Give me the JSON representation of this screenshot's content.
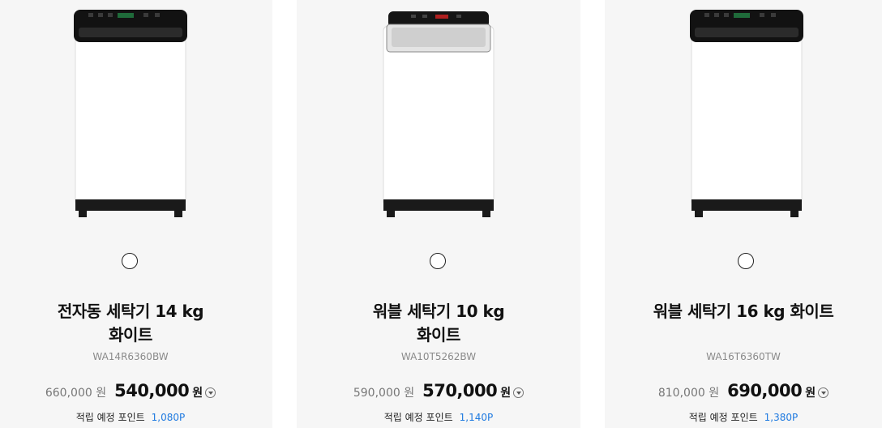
{
  "products": [
    {
      "title_line1": "전자동 세탁기 14 kg",
      "title_line2": "화이트",
      "model": "WA14R6360BW",
      "original_price": "660,000 원",
      "sale_price": "540,000",
      "sale_unit": "원",
      "points_label": "적립 예정 포인트",
      "points_value": "1,080P"
    },
    {
      "title_line1": "워블 세탁기 10 kg",
      "title_line2": "화이트",
      "model": "WA10T5262BW",
      "original_price": "590,000 원",
      "sale_price": "570,000",
      "sale_unit": "원",
      "points_label": "적립 예정 포인트",
      "points_value": "1,140P"
    },
    {
      "title_line1": "워블 세탁기 16 kg 화이트",
      "title_line2": "",
      "model": "WA16T6360TW",
      "original_price": "810,000 원",
      "sale_price": "690,000",
      "sale_unit": "원",
      "points_label": "적립 예정 포인트",
      "points_value": "1,380P"
    }
  ],
  "colors": {
    "card_bg": "#f6f6f6",
    "points_accent": "#1f7ae0",
    "washer_body": "#ffffff",
    "washer_panel": "#111111"
  }
}
